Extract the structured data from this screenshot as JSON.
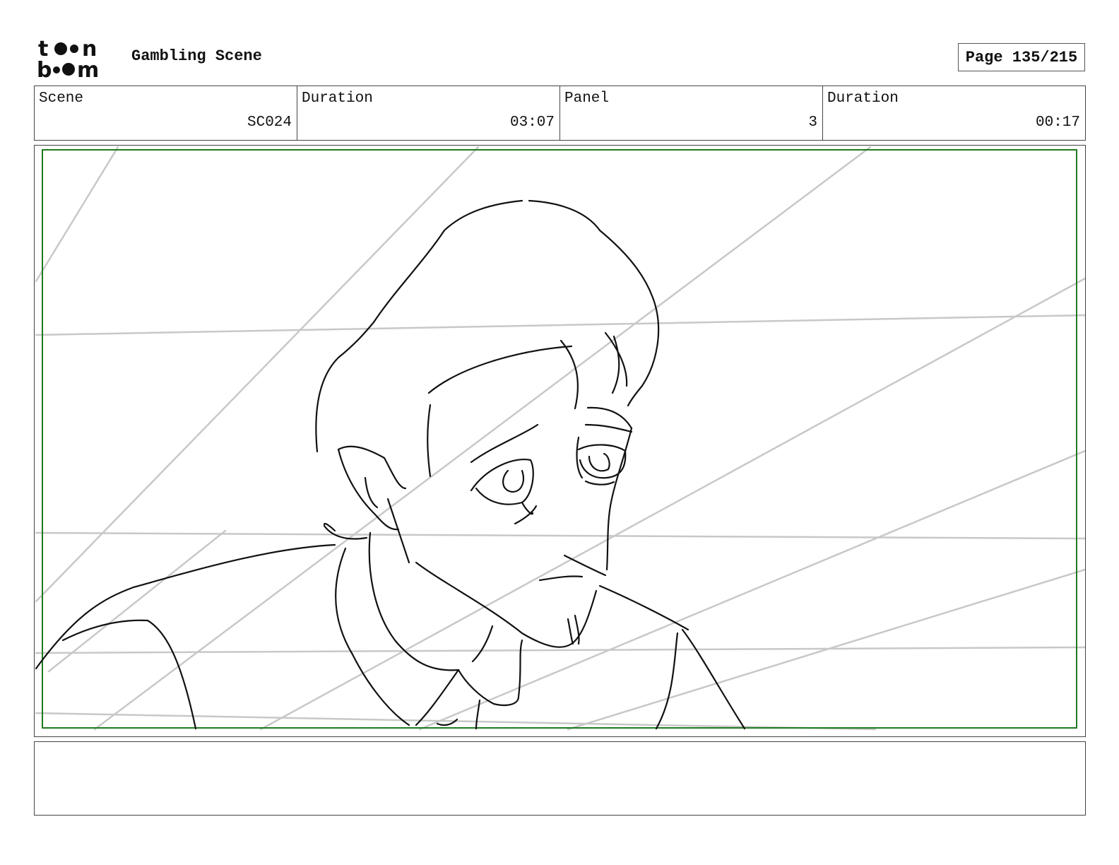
{
  "header": {
    "logo_text": "toon boom",
    "title": "Gambling Scene",
    "page": "Page 135/215"
  },
  "info": {
    "scene_label": "Scene",
    "scene_value": "SC024",
    "scene_duration_label": "Duration",
    "scene_duration_value": "03:07",
    "panel_label": "Panel",
    "panel_value": "3",
    "panel_duration_label": "Duration",
    "panel_duration_value": "00:17"
  },
  "panel": {
    "safe_frame_color": "#1f7a1f",
    "guide_line_color": "#c8c8c8",
    "sketch_color": "#111111"
  },
  "notes": {
    "text": ""
  }
}
